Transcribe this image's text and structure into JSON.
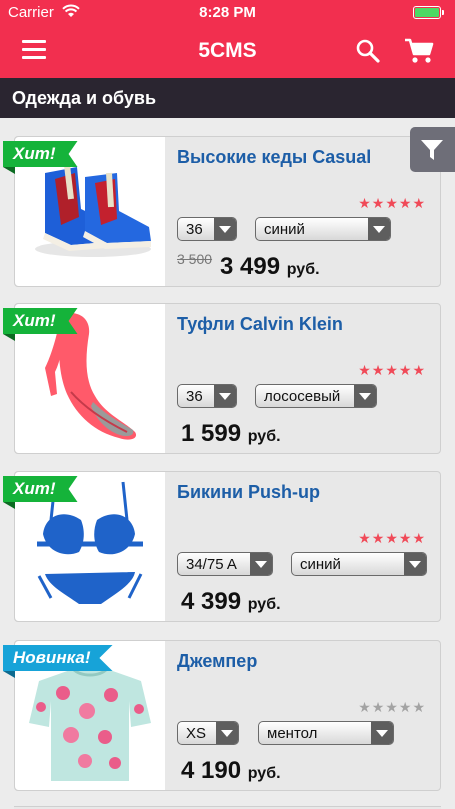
{
  "status_bar": {
    "carrier": "Carrier",
    "time": "8:28 PM"
  },
  "nav": {
    "title": "5CMS"
  },
  "category": {
    "title": "Одежда и обувь"
  },
  "currency": "руб.",
  "products": [
    {
      "badge": "Хит!",
      "name": "Высокие кеды Casual",
      "size": "36",
      "color": "синий",
      "old_price": "3 500",
      "price": "3 499",
      "rating": 5
    },
    {
      "badge": "Хит!",
      "name": "Туфли Calvin Klein",
      "size": "36",
      "color": "лососевый",
      "price": "1 599",
      "rating": 5
    },
    {
      "badge": "Хит!",
      "name": "Бикини Push-up",
      "size": "34/75 A",
      "color": "синий",
      "price": "4 399",
      "rating": 5
    },
    {
      "badge": "Новинка!",
      "name": "Джемпер",
      "size": "XS",
      "color": "ментол",
      "price": "4 190",
      "rating": 0
    }
  ],
  "colors": {
    "brand": "#f22f4f",
    "category_bar": "#2a2530",
    "product_name": "#1d5ea7",
    "badge_hit": "#15b33a",
    "badge_new": "#17a3d8",
    "star": "#f04a58"
  }
}
